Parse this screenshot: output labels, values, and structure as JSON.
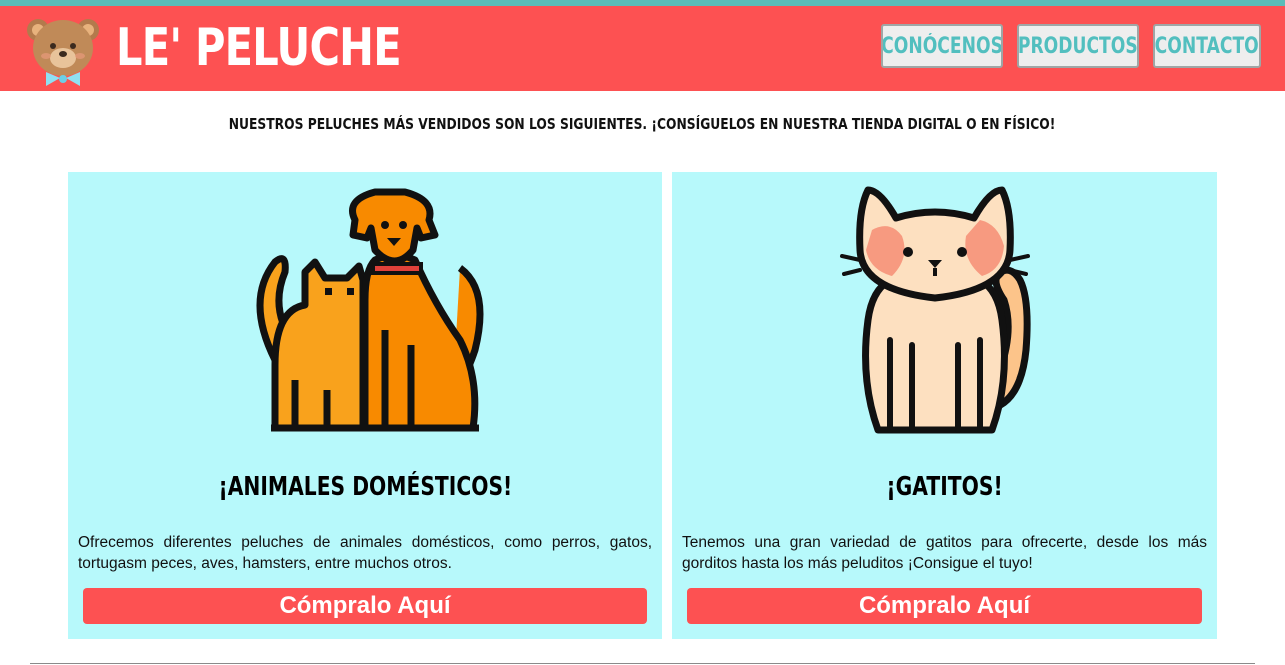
{
  "header": {
    "brand": "LE' PELUCHE",
    "logo_icon": "teddy-bear-icon",
    "nav": [
      {
        "label": "CONÓCENOS"
      },
      {
        "label": "PRODUCTOS"
      },
      {
        "label": "CONTACTO"
      }
    ]
  },
  "intro": "NUESTROS PELUCHES MÁS VENDIDOS SON LOS SIGUIENTES. ¡CONSÍGUELOS EN NUESTRA TIENDA DIGITAL O EN FÍSICO!",
  "cards": [
    {
      "icon": "dog-and-cat-icon",
      "title": "¡ANIMALES DOMÉSTICOS!",
      "text": "Ofrecemos diferentes peluches de animales domésticos, como perros, gatos, tortugasm peces, aves, hamsters, entre muchos otros.",
      "button": "Cómpralo Aquí"
    },
    {
      "icon": "cat-icon",
      "title": "¡GATITOS!",
      "text": "Tenemos una gran variedad de gatitos para ofrecerte, desde los más gorditos hasta los más peluditos ¡Consigue el tuyo!",
      "button": "Cómpralo Aquí"
    }
  ],
  "colors": {
    "header_bg": "#fd5152",
    "top_stripe": "#5bbcb8",
    "nav_text": "#52bfbf",
    "card_bg": "#b7f9fb",
    "button_bg": "#fd5152"
  }
}
